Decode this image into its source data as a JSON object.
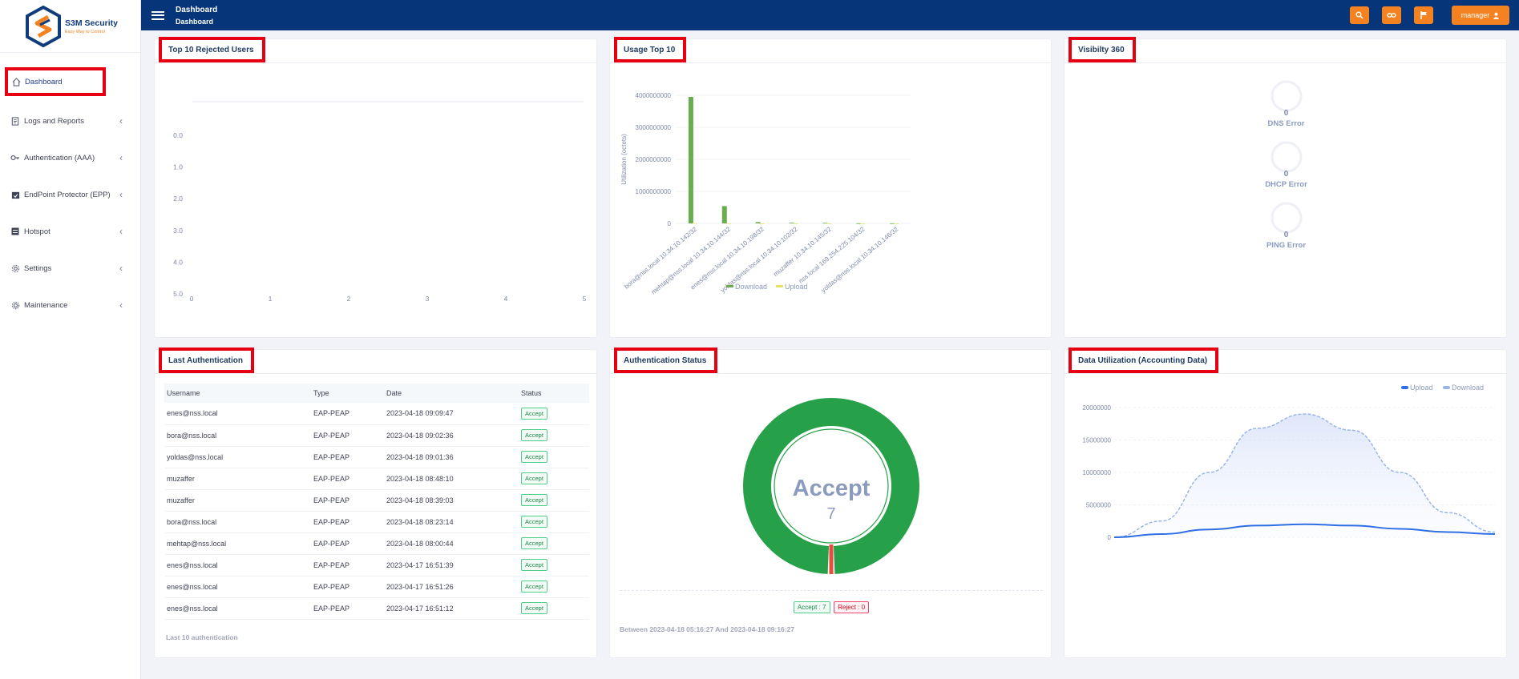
{
  "brand": {
    "name": "S3M Security",
    "tagline": "Easy Way to Control"
  },
  "topbar": {
    "title": "Dashboard",
    "subtitle": "Dashboard",
    "user_label": "manager"
  },
  "sidebar": {
    "items": [
      {
        "label": "Dashboard",
        "icon": "home-icon"
      },
      {
        "label": "Logs and Reports",
        "icon": "document-icon"
      },
      {
        "label": "Authentication (AAA)",
        "icon": "key-icon"
      },
      {
        "label": "EndPoint Protector (EPP)",
        "icon": "calendar-check-icon"
      },
      {
        "label": "Hotspot",
        "icon": "list-icon"
      },
      {
        "label": "Settings",
        "icon": "gear-icon"
      },
      {
        "label": "Maintenance",
        "icon": "cog-icon"
      }
    ]
  },
  "cards": {
    "rejected": {
      "title": "Top 10 Rejected Users"
    },
    "usage": {
      "title": "Usage Top 10"
    },
    "visibility": {
      "title": "Visibilty 360"
    },
    "last_auth": {
      "title": "Last Authentication"
    },
    "auth_status": {
      "title": "Authentication Status"
    },
    "data_util": {
      "title": "Data Utilization (Accounting Data)"
    }
  },
  "visibility": [
    {
      "value": "0",
      "label": "DNS Error"
    },
    {
      "value": "0",
      "label": "DHCP Error"
    },
    {
      "value": "0",
      "label": "PING Error"
    }
  ],
  "last_auth": {
    "columns": [
      "Username",
      "Type",
      "Date",
      "Status"
    ],
    "rows": [
      [
        "enes@nss.local",
        "EAP-PEAP",
        "2023-04-18 09:09:47",
        "Accept"
      ],
      [
        "bora@nss.local",
        "EAP-PEAP",
        "2023-04-18 09:02:36",
        "Accept"
      ],
      [
        "yoldas@nss.local",
        "EAP-PEAP",
        "2023-04-18 09:01:36",
        "Accept"
      ],
      [
        "muzaffer",
        "EAP-PEAP",
        "2023-04-18 08:48:10",
        "Accept"
      ],
      [
        "muzaffer",
        "EAP-PEAP",
        "2023-04-18 08:39:03",
        "Accept"
      ],
      [
        "bora@nss.local",
        "EAP-PEAP",
        "2023-04-18 08:23:14",
        "Accept"
      ],
      [
        "mehtap@nss.local",
        "EAP-PEAP",
        "2023-04-18 08:00:44",
        "Accept"
      ],
      [
        "enes@nss.local",
        "EAP-PEAP",
        "2023-04-17 16:51:39",
        "Accept"
      ],
      [
        "enes@nss.local",
        "EAP-PEAP",
        "2023-04-17 16:51:26",
        "Accept"
      ],
      [
        "enes@nss.local",
        "EAP-PEAP",
        "2023-04-17 16:51:12",
        "Accept"
      ]
    ],
    "footer": "Last 10 authentication"
  },
  "auth_status": {
    "center_label": "Accept",
    "center_value": "7",
    "accept_badge": "Accept : 7",
    "reject_badge": "Reject : 0",
    "range_text": "Between 2023-04-18 05:16:27 And 2023-04-18 09:16:27"
  },
  "colors": {
    "accent": "#f58220",
    "topbar": "#06357a",
    "accept": "#27a04a",
    "reject": "#e74c3c",
    "highlight": "#e60012"
  },
  "chart_data": [
    {
      "type": "bar",
      "title": "Top 10 Rejected Users",
      "orientation": "horizontal",
      "categories": [
        "0.0",
        "1.0",
        "2.0",
        "3.0",
        "4.0",
        "5.0"
      ],
      "x_ticks": [
        "0",
        "1",
        "2",
        "3",
        "4",
        "5"
      ],
      "series": []
    },
    {
      "type": "bar",
      "title": "Usage Top 10",
      "ylabel": "Utilization (octets)",
      "ylim": [
        0,
        4000000000
      ],
      "y_ticks": [
        "4000000000",
        "3000000000",
        "2000000000",
        "1000000000",
        "0"
      ],
      "categories": [
        "bora@nss.local 10.34.10.142/32",
        "mehtap@nss.local 10.34.10.144/32",
        "enes@nss.local 10.34.10.198/32",
        "yoldas@nss.local 10.34.10.102/32",
        "muzaffer 10.34.10.145/32",
        "nss.local 169.254.225.104/32",
        "yoldas@nss.local 10.34.10.146/32"
      ],
      "series": [
        {
          "name": "Download",
          "values": [
            3950000000,
            540000000,
            40000000,
            20000000,
            15000000,
            3000000,
            2000000
          ]
        },
        {
          "name": "Upload",
          "values": [
            8000000,
            3000000,
            1000000,
            1000000,
            500000,
            100000,
            100000
          ]
        }
      ],
      "legend": "bottom"
    },
    {
      "type": "pie",
      "title": "Authentication Status",
      "categories": [
        "Accept",
        "Reject"
      ],
      "values": [
        7,
        0
      ]
    },
    {
      "type": "area",
      "title": "Data Utilization (Accounting Data)",
      "ylim": [
        0,
        20000000
      ],
      "y_ticks": [
        "20000000",
        "15000000",
        "10000000",
        "5000000",
        "0"
      ],
      "x": [
        0,
        1,
        2,
        3,
        4,
        5,
        6,
        7,
        8
      ],
      "series": [
        {
          "name": "Upload",
          "values": [
            0,
            500000,
            1200000,
            1800000,
            2000000,
            1800000,
            1300000,
            800000,
            500000
          ]
        },
        {
          "name": "Download",
          "values": [
            0,
            2500000,
            10000000,
            16800000,
            19000000,
            16500000,
            10000000,
            3800000,
            800000
          ]
        }
      ],
      "legend": "top-right"
    }
  ]
}
